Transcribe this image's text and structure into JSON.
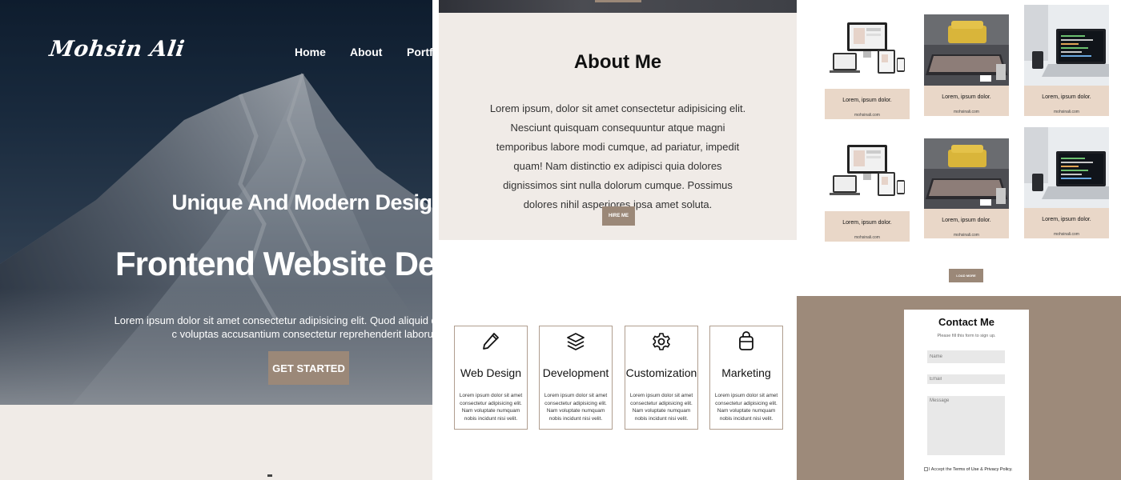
{
  "colors": {
    "accent": "#9b8878",
    "about_bg": "#f0ebe7",
    "contact_bg": "#9d8a7a",
    "card_bg": "#e9d7c8"
  },
  "hero": {
    "logo": "Mohsin Ali",
    "nav": [
      "Home",
      "About",
      "Portfoli"
    ],
    "subtitle": "Unique And Modern Design",
    "title": "Frontend Website Develop",
    "text": "Lorem ipsum dolor sit amet consectetur adipisicing elit. Quod aliquid quam commodi c voluptas accusantium consectetur reprehenderit laborum.",
    "button": "GET STARTED"
  },
  "about": {
    "title": "About Me",
    "text": "Lorem ipsum, dolor sit amet consectetur adipisicing elit. Nesciunt quisquam consequuntur atque magni temporibus labore modi cumque, ad pariatur, impedit quam! Nam distinctio ex adipisci quia dolores dignissimos sint nulla dolorum cumque. Possimus dolores nihil asperiores ipsa amet soluta.",
    "button": "HIRE ME"
  },
  "services": [
    {
      "icon": "pencil-icon",
      "title": "Web Design",
      "text": "Lorem ipsum dolor sit amet consectetur adipisicing elit. Nam voluptate numquam nobis incidunt nisi velit."
    },
    {
      "icon": "layers-icon",
      "title": "Development",
      "text": "Lorem ipsum dolor sit amet consectetur adipisicing elit. Nam voluptate numquam nobis incidunt nisi velit."
    },
    {
      "icon": "gear-icon",
      "title": "Customization",
      "text": "Lorem ipsum dolor sit amet consectetur adipisicing elit. Nam voluptate numquam nobis incidunt nisi velit."
    },
    {
      "icon": "bag-icon",
      "title": "Marketing",
      "text": "Lorem ipsum dolor sit amet consectetur adipisicing elit. Nam voluptate numquam nobis incidunt nisi velit."
    }
  ],
  "portfolio": {
    "items": [
      {
        "caption": "Lorem, ipsum dolor.",
        "site": "mohsinali.com",
        "image": "devices-mockup-image"
      },
      {
        "caption": "Lorem, ipsum dolor.",
        "site": "mohsinali.com",
        "image": "laptop-desk-image"
      },
      {
        "caption": "Lorem, ipsum dolor.",
        "site": "mohsinali.com",
        "image": "code-laptop-image"
      },
      {
        "caption": "Lorem, ipsum dolor.",
        "site": "mohsinali.com",
        "image": "devices-mockup-image"
      },
      {
        "caption": "Lorem, ipsum dolor.",
        "site": "mohsinali.com",
        "image": "laptop-desk-image"
      },
      {
        "caption": "Lorem, ipsum dolor.",
        "site": "mohsinali.com",
        "image": "code-laptop-image"
      }
    ],
    "load_more": "LOAD MORE"
  },
  "contact": {
    "title": "Contact Me",
    "subtitle": "Please fill this form to sign up.",
    "name_placeholder": "Name",
    "email_placeholder": "Email",
    "message_placeholder": "Message",
    "terms_prefix": "I Accept the ",
    "terms_link": "Terms of Use",
    "terms_and": " & ",
    "privacy_link": "Privacy Policy."
  }
}
